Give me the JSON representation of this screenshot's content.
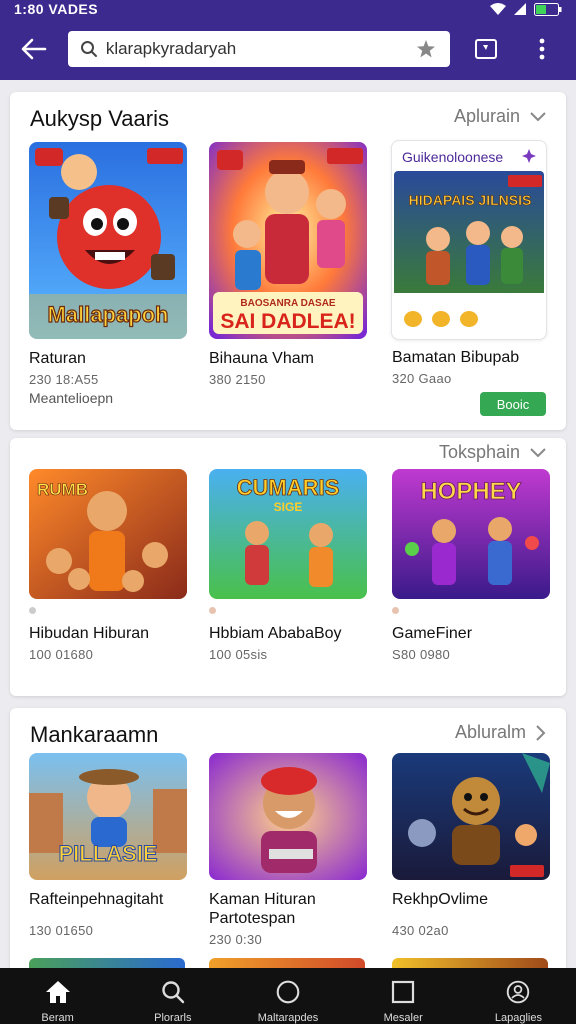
{
  "status": {
    "time": "1:80 VADES"
  },
  "search": {
    "query": "klarapkyradaryah"
  },
  "sections": [
    {
      "title": "Aukysp Vaaris",
      "action": "Aplurain",
      "cards": [
        {
          "name": "Raturan",
          "meta": "230 18:A55",
          "sub": "Meantelioepn",
          "art": "Mallapapoh"
        },
        {
          "name": "Bihauna Vham",
          "meta": "380 2150",
          "art": "SAI DADLEA!",
          "art_top": "BAOSANRA DASAE"
        },
        {
          "name": "Bamatan Bibupab",
          "meta": "320 Gaao"
        }
      ],
      "featured": {
        "title": "Guikenoloonese",
        "art": "HIDAPAIS JILNSIS"
      },
      "install_label": "Booic"
    },
    {
      "title": "",
      "action": "Toksphain",
      "cards": [
        {
          "name": "Hibudan Hiburan",
          "meta": "100 01680",
          "art": "RUMB"
        },
        {
          "name": "Hbbiam AbabaBoy",
          "meta": "100 05sis",
          "art": "CUMARIS",
          "art_sub": "SIGE"
        },
        {
          "name": "GameFiner",
          "meta": "S80 0980",
          "art": "HOPHEY"
        }
      ]
    },
    {
      "title": "Mankaraamn",
      "action": "Abluralm",
      "cards": [
        {
          "name": "Rafteinpehnagitaht",
          "meta": "130 01650",
          "art": "PILLASIE"
        },
        {
          "name": "Kaman Hituran Partotespan",
          "meta": "230 0:30"
        },
        {
          "name": "RekhpOvlime",
          "meta": "430 02a0"
        }
      ]
    }
  ],
  "nav": [
    {
      "label": "Beram",
      "icon": "home-icon"
    },
    {
      "label": "Plorarls",
      "icon": "search-icon"
    },
    {
      "label": "Maltarapdes",
      "icon": "circle-icon"
    },
    {
      "label": "Mesaler",
      "icon": "square-icon"
    },
    {
      "label": "Lapaglies",
      "icon": "profile-icon"
    }
  ],
  "colors": {
    "app_bar": "#3d2a8f",
    "install": "#34a853",
    "nav_bg": "#111111",
    "featured_title": "#4d2a9a"
  }
}
